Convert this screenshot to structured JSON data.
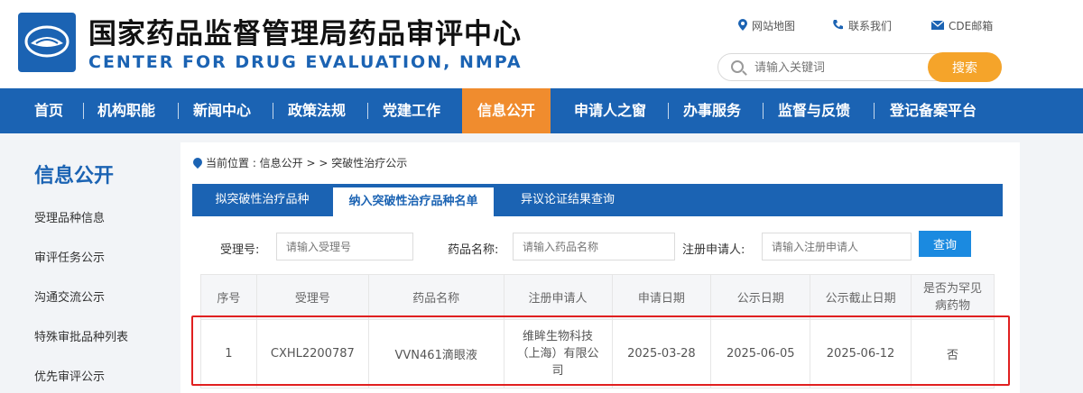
{
  "header": {
    "title": "国家药品监督管理局药品审评中心",
    "subtitle": "CENTER FOR DRUG EVALUATION, NMPA",
    "links": [
      {
        "icon": "location-icon",
        "label": "网站地图"
      },
      {
        "icon": "phone-icon",
        "label": "联系我们"
      },
      {
        "icon": "mail-icon",
        "label": "CDE邮箱"
      }
    ],
    "search": {
      "placeholder": "请输入关键词",
      "button": "搜索"
    }
  },
  "nav": [
    "首页",
    "机构职能",
    "新闻中心",
    "政策法规",
    "党建工作",
    "信息公开",
    "申请人之窗",
    "办事服务",
    "监督与反馈",
    "登记备案平台"
  ],
  "nav_active": "信息公开",
  "sidebar": {
    "title": "信息公开",
    "items": [
      "受理品种信息",
      "审评任务公示",
      "沟通交流公示",
      "特殊审批品种列表",
      "优先审评公示"
    ]
  },
  "breadcrumb": {
    "label": "当前位置 : 信息公开 > > 突破性治疗公示"
  },
  "tabs": [
    "拟突破性治疗品种",
    "纳入突破性治疗品种名单",
    "异议论证结果查询"
  ],
  "filter": {
    "accept_label": "受理号:",
    "accept_placeholder": "请输入受理号",
    "drug_label": "药品名称:",
    "drug_placeholder": "请输入药品名称",
    "applicant_label": "注册申请人:",
    "applicant_placeholder": "请输入注册申请人",
    "query_button": "查询"
  },
  "table": {
    "headers": [
      "序号",
      "受理号",
      "药品名称",
      "注册申请人",
      "申请日期",
      "公示日期",
      "公示截止日期",
      "是否为罕见病药物"
    ],
    "rows": [
      [
        "1",
        "CXHL2200787",
        "VVN461滴眼液",
        "维眸生物科技（上海）有限公司",
        "2025-03-28",
        "2025-06-05",
        "2025-06-12",
        "否"
      ]
    ]
  },
  "colors": {
    "primary": "#1b63b3",
    "accent": "#f08c2e",
    "search_button": "#f5a42a",
    "highlight": "#e02020"
  }
}
